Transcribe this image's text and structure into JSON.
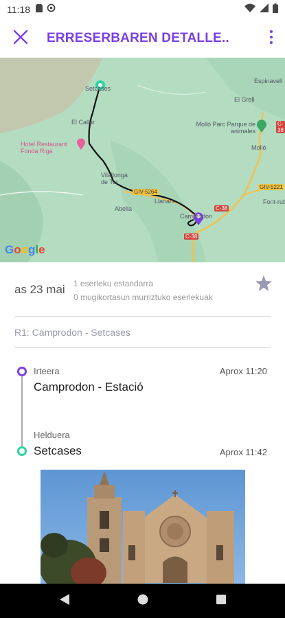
{
  "status_bar": {
    "time": "11:18",
    "icons": [
      "sd-card-icon",
      "sync-icon",
      "wifi-icon",
      "signal-icon",
      "battery-icon"
    ]
  },
  "app_bar": {
    "title": "ERRESERBAREN DETALLE..",
    "accent_color": "#7b3fe4"
  },
  "map": {
    "labels": [
      "Setcases",
      "El Callar",
      "Hotel Restaurant Fonda Rigà",
      "Vilallonga de Ter",
      "Abella",
      "Llanars",
      "Camprodon",
      "Espinavell",
      "El Grell",
      "Molló Parc Parque de animales",
      "Molló",
      "Font-rub"
    ],
    "road_badges": [
      "GIV-5264",
      "C-38",
      "C-38",
      "GIV-5221",
      "C-38"
    ],
    "google_logo": "Google",
    "start_color": "#2ed5a0",
    "end_color": "#7b3fe4"
  },
  "booking": {
    "date": "as 23 mai",
    "seat_standard": "1 eserleku estandarra",
    "seat_reduced": "0 mugikortasun murriztuko eserlekuak"
  },
  "route": {
    "title": "R1: Camprodon - Setcases"
  },
  "departure": {
    "kind": "Irteera",
    "stop": "Camprodon - Estació",
    "time": "Aprox 11:20"
  },
  "arrival": {
    "kind": "Helduera",
    "stop": "Setcases",
    "time": "Aprox 11:42"
  },
  "photo": {
    "icon": "church-photo"
  },
  "nav_bar": {
    "buttons": [
      "back-icon",
      "home-icon",
      "recents-icon"
    ]
  }
}
